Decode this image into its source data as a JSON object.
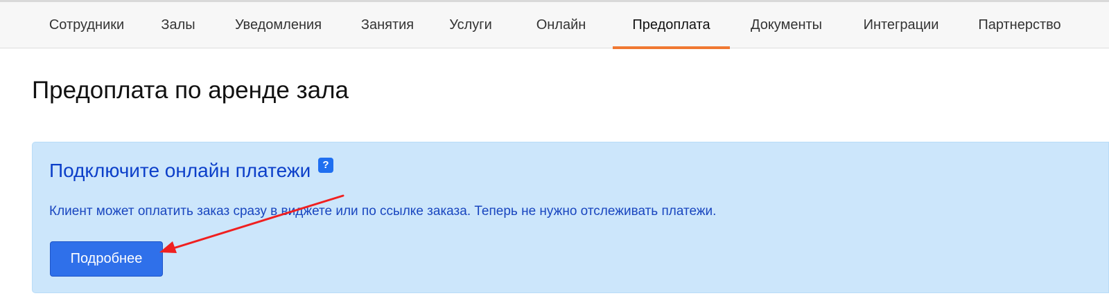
{
  "navigation": {
    "tabs": [
      {
        "label": "Сотрудники",
        "active": false
      },
      {
        "label": "Залы",
        "active": false
      },
      {
        "label": "Уведомления",
        "active": false
      },
      {
        "label": "Занятия",
        "active": false
      },
      {
        "label": "Услуги",
        "active": false
      },
      {
        "label": "Онлайн",
        "active": false
      },
      {
        "label": "Предоплата",
        "active": true
      },
      {
        "label": "Документы",
        "active": false
      },
      {
        "label": "Интеграции",
        "active": false
      },
      {
        "label": "Партнерство",
        "active": false
      }
    ]
  },
  "page": {
    "title": "Предоплата по аренде зала"
  },
  "promo": {
    "title": "Подключите онлайн платежи",
    "help_symbol": "?",
    "description": "Клиент может оплатить заказ сразу в виджете или по ссылке заказа. Теперь не нужно отслеживать платежи.",
    "button_label": "Подробнее"
  },
  "icons": {
    "help": "help-icon",
    "annotation": "red-arrow-icon"
  },
  "colors": {
    "active_tab_underline": "#f07832",
    "panel_background": "#cce6fb",
    "panel_text": "#1946bf",
    "button_background": "#2f70ea",
    "annotation_arrow": "#f02020"
  }
}
